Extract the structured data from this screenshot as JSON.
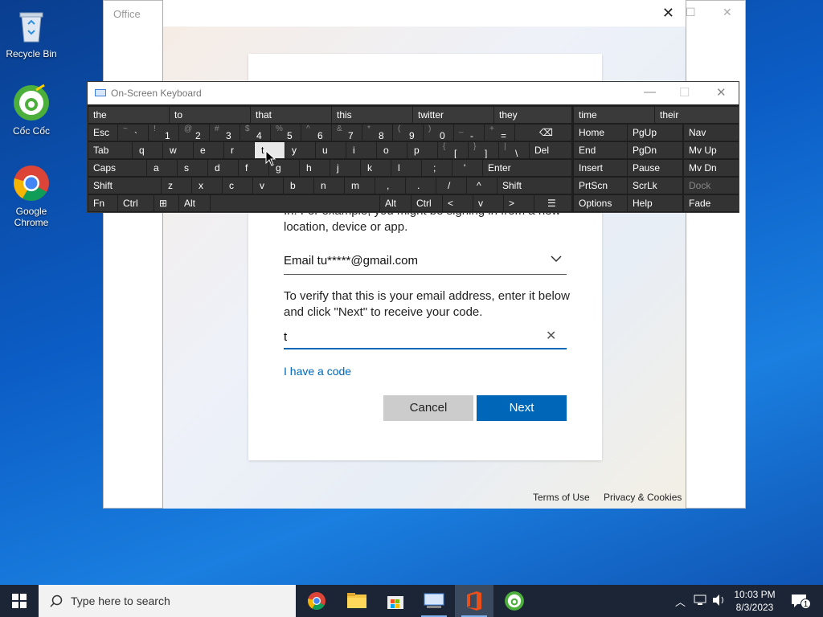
{
  "desktop": {
    "icons": [
      {
        "label": "Recycle Bin"
      },
      {
        "label": "Cốc Cốc"
      },
      {
        "label": "Google Chrome"
      }
    ]
  },
  "office_window": {
    "title": "Office"
  },
  "dialog": {
    "partial_text": "In. For example, you might be signing in from a new location, device or app.",
    "email_option": "Email tu*****@gmail.com",
    "verify_text": "To verify that this is your email address, enter it below and click \"Next\" to receive your code.",
    "code_value": "t",
    "have_code_link": "I have a code",
    "cancel_label": "Cancel",
    "next_label": "Next",
    "terms_label": "Terms of Use",
    "privacy_label": "Privacy & Cookies"
  },
  "osk": {
    "title": "On-Screen Keyboard",
    "predictions": [
      "the",
      "to",
      "that",
      "this",
      "twitter",
      "they",
      "time",
      "their"
    ],
    "row1": [
      {
        "main": "Esc"
      },
      {
        "sym": "~",
        "main": "`"
      },
      {
        "sym": "!",
        "main": "1"
      },
      {
        "sym": "@",
        "main": "2"
      },
      {
        "sym": "#",
        "main": "3"
      },
      {
        "sym": "$",
        "main": "4"
      },
      {
        "sym": "%",
        "main": "5"
      },
      {
        "sym": "^",
        "main": "6"
      },
      {
        "sym": "&",
        "main": "7"
      },
      {
        "sym": "*",
        "main": "8"
      },
      {
        "sym": "(",
        "main": "9"
      },
      {
        "sym": ")",
        "main": "0"
      },
      {
        "sym": "_",
        "main": "-"
      },
      {
        "sym": "+",
        "main": "="
      },
      {
        "main": "⌫"
      }
    ],
    "row2": [
      "Tab",
      "q",
      "w",
      "e",
      "r",
      "t",
      "y",
      "u",
      "i",
      "o",
      "p",
      "[",
      "]",
      "\\",
      "Del"
    ],
    "row2_syms": {
      "[": "{",
      "]": "}",
      "\\": "|"
    },
    "row3": [
      "Caps",
      "a",
      "s",
      "d",
      "f",
      "g",
      "h",
      "j",
      "k",
      "l",
      ";",
      "'",
      "Enter"
    ],
    "row4": [
      "Shift",
      "z",
      "x",
      "c",
      "v",
      "b",
      "n",
      "m",
      ",",
      ".",
      "/",
      "^",
      "Shift"
    ],
    "row5": [
      "Fn",
      "Ctrl",
      "⊞",
      "Alt",
      "Alt",
      "Ctrl",
      "<",
      "v",
      ">",
      "☰"
    ],
    "nav_keys": [
      [
        "Home",
        "PgUp",
        "Nav"
      ],
      [
        "End",
        "PgDn",
        "Mv Up"
      ],
      [
        "Insert",
        "Pause",
        "Mv Dn"
      ],
      [
        "PrtScn",
        "ScrLk",
        "Dock"
      ],
      [
        "Options",
        "Help",
        "Fade"
      ]
    ]
  },
  "taskbar": {
    "search_placeholder": "Type here to search",
    "time": "10:03 PM",
    "date": "8/3/2023",
    "notification_count": "1"
  },
  "colors": {
    "accent": "#0067b8",
    "osk_key": "#333333",
    "taskbar": "#1b2535"
  }
}
